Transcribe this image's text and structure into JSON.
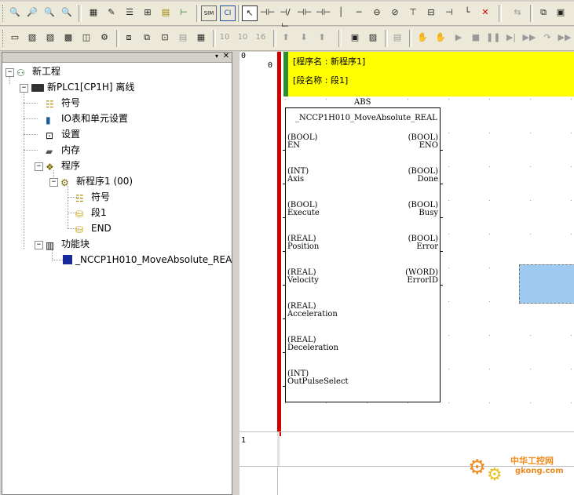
{
  "toolbar_row1": {
    "icons": [
      "zoom-small-icon",
      "zoom-in-icon",
      "zoom-out-icon",
      "zoom-reset-icon",
      "grid-icon",
      "comment-icon",
      "list-icon",
      "cross-ref-icon",
      "monitor-icon",
      "tree-icon",
      "sim-icon",
      "ci-icon",
      "select-pointer-icon",
      "contact-no-icon",
      "contact-nc-icon",
      "contact-or-icon",
      "contact-or-nc-icon",
      "vertical-line-icon",
      "horizontal-line-icon",
      "coil-icon",
      "coil-nc-icon",
      "instruction-icon",
      "fb-icon",
      "set-icon",
      "line-end-icon",
      "delete-icon",
      "transfer-icon",
      "compare-icon",
      "program-icon"
    ]
  },
  "toolbar_row2": {
    "icons": [
      "window-icon",
      "properties-icon",
      "chart-icon",
      "watch-icon",
      "io-icon",
      "task-icon",
      "function-icon",
      "online-edit-icon",
      "mem-icon",
      "copy-icon",
      "export-icon",
      "number-10-icon",
      "number-10h-icon",
      "number-16-icon",
      "upload-icon",
      "download-icon",
      "network-icon",
      "monitor2-icon",
      "settings-icon",
      "step-icon",
      "step2-icon",
      "run-icon",
      "stop-icon",
      "pause-icon",
      "step-run-icon",
      "jump-icon",
      "fast-icon"
    ],
    "labels": [
      "10",
      "10",
      "16"
    ]
  },
  "tree": {
    "root": "新工程",
    "plc": "新PLC1[CP1H] 离线",
    "symbols": "符号",
    "io_table": "IO表和单元设置",
    "settings": "设置",
    "memory": "内存",
    "programs": "程序",
    "program1": "新程序1 (00)",
    "prog_symbols": "符号",
    "section1": "段1",
    "end": "END",
    "function_blocks": "功能块",
    "fb_instance": "_NCCP1H010_MoveAbsolute_REA"
  },
  "editor": {
    "rung0_addr": "0",
    "rung0_step": "0",
    "rung1_addr": "1",
    "program_name_line": "[程序名 : 新程序1]",
    "section_name_line": "[段名称 : 段1]",
    "fb_instance_name": "ABS",
    "fb_type": "_NCCP1H010_MoveAbsolute_REAL",
    "inputs": [
      {
        "type": "(BOOL)",
        "name": "EN"
      },
      {
        "type": "(INT)",
        "name": "Axis"
      },
      {
        "type": "(BOOL)",
        "name": "Execute"
      },
      {
        "type": "(REAL)",
        "name": "Position"
      },
      {
        "type": "(REAL)",
        "name": "Velocity"
      },
      {
        "type": "(REAL)",
        "name": "Acceleration"
      },
      {
        "type": "(REAL)",
        "name": "Deceleration"
      },
      {
        "type": "(INT)",
        "name": "OutPulseSelect"
      }
    ],
    "outputs": [
      {
        "type": "(BOOL)",
        "name": "ENO"
      },
      {
        "type": "(BOOL)",
        "name": "Done"
      },
      {
        "type": "(BOOL)",
        "name": "Busy"
      },
      {
        "type": "(BOOL)",
        "name": "Error"
      },
      {
        "type": "(WORD)",
        "name": "ErrorID"
      }
    ]
  },
  "watermark": {
    "text_cn": "中华工控网",
    "text_url": "gkong.com"
  },
  "colors": {
    "rung_bar": "#d00000",
    "header_bg": "#ffff00",
    "header_mark": "#2e8b2e",
    "selection": "#9ec9f0",
    "watermark_orange": "#f08a1c"
  }
}
